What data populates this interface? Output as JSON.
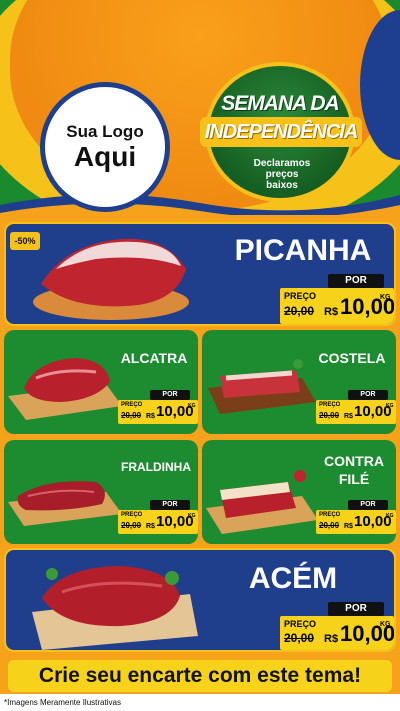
{
  "header": {
    "logo_line1": "Sua Logo",
    "logo_line2": "Aqui",
    "badge_title_line1": "SEMANA DA",
    "badge_title_line2": "INDEPENDÊNCIA",
    "badge_subtitle": "Declaramos preços baixos"
  },
  "colors": {
    "blue": "#1f3f8c",
    "green": "#1d8b2f",
    "orange": "#f7a21b",
    "yellow": "#f6d31a"
  },
  "discount_badge": "-50%",
  "products": [
    {
      "name": "PICANHA",
      "por": "POR",
      "preco_label": "PREÇO",
      "old_price": "20,00",
      "currency": "R$",
      "price": "10,00",
      "unit": "KG"
    },
    {
      "name": "ALCATRA",
      "por": "POR",
      "preco_label": "PREÇO",
      "old_price": "20,00",
      "currency": "R$",
      "price": "10,00",
      "unit": "KG"
    },
    {
      "name": "COSTELA",
      "por": "POR",
      "preco_label": "PREÇO",
      "old_price": "20,00",
      "currency": "R$",
      "price": "10,00",
      "unit": "KG"
    },
    {
      "name": "FRALDINHA",
      "por": "POR",
      "preco_label": "PREÇO",
      "old_price": "20,00",
      "currency": "R$",
      "price": "10,00",
      "unit": "KG"
    },
    {
      "name_line1": "CONTRA",
      "name_line2": "FILÉ",
      "por": "POR",
      "preco_label": "PREÇO",
      "old_price": "20,00",
      "currency": "R$",
      "price": "10,00",
      "unit": "KG"
    },
    {
      "name": "ACÉM",
      "por": "POR",
      "preco_label": "PREÇO",
      "old_price": "20,00",
      "currency": "R$",
      "price": "10,00",
      "unit": "KG"
    }
  ],
  "cta": "Crie seu encarte com este tema!",
  "footer_note": "*Imagens Meramente Ilustrativas"
}
